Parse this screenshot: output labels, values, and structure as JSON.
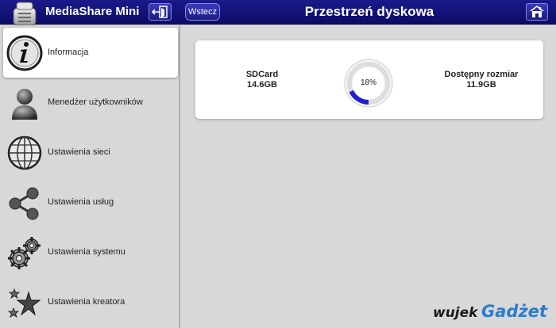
{
  "header": {
    "app_title": "MediaShare Mini",
    "back_label": "Wstecz",
    "page_title": "Przestrzeń dyskowa"
  },
  "sidebar": {
    "items": [
      {
        "label": "Informacja",
        "icon": "info-icon",
        "active": true
      },
      {
        "label": "Menedżer użytkowników",
        "icon": "user-icon",
        "active": false
      },
      {
        "label": "Ustawienia sieci",
        "icon": "globe-icon",
        "active": false
      },
      {
        "label": "Ustawienia usług",
        "icon": "share-icon",
        "active": false
      },
      {
        "label": "Ustawienia systemu",
        "icon": "gears-icon",
        "active": false
      },
      {
        "label": "Ustawienia kreatora",
        "icon": "stars-icon",
        "active": false
      }
    ]
  },
  "storage": {
    "device_name": "SDCard",
    "device_size": "14.6GB",
    "usage_percent_label": "18%",
    "usage_fraction": 0.18,
    "available_label": "Dostępny rozmiar",
    "available_size": "11.9GB"
  },
  "watermark": {
    "part1": "wujek",
    "part2": "Gadżet"
  },
  "colors": {
    "header_bg": "#10107a",
    "gauge_fill": "#2222cc",
    "gauge_track": "#dddddd",
    "watermark_accent": "#2a7bd0"
  }
}
